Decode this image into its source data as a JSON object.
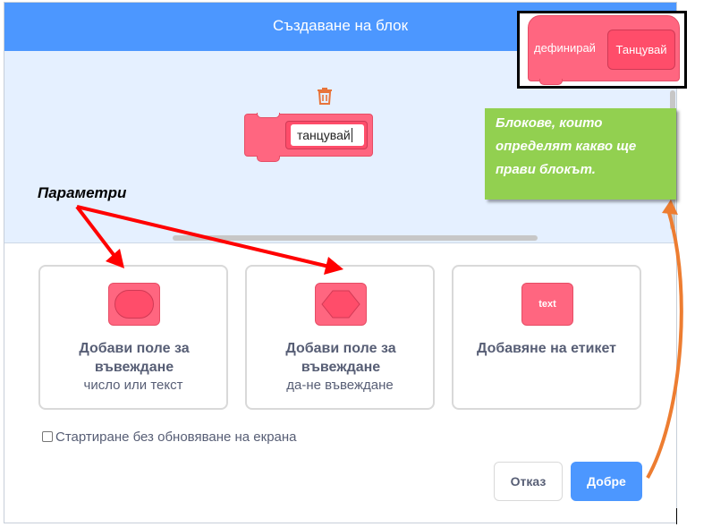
{
  "dialog": {
    "title": "Създаване на блок"
  },
  "prototype_block": {
    "input_value": "танцувай"
  },
  "options": [
    {
      "title": "Добави поле за въвеждане",
      "subtitle": "число или текст",
      "icon": "round-input-icon"
    },
    {
      "title": "Добави поле за въвеждане",
      "subtitle": "да-не въвеждане",
      "icon": "boolean-input-icon"
    },
    {
      "title": "Добавяне на етикет",
      "subtitle": "",
      "icon": "label-icon",
      "icon_text": "text"
    }
  ],
  "checkbox": {
    "label": "Стартиране без обновяване на екрана",
    "checked": false
  },
  "buttons": {
    "cancel": "Отказ",
    "ok": "Добре"
  },
  "annotations": {
    "params_label": "Параметри",
    "note_text": "Блокове, които определят какво ще прави блокът.",
    "inset_define": "дефинирай",
    "inset_name": "Танцувай"
  },
  "colors": {
    "header": "#4c97ff",
    "block": "#ff6680",
    "note": "#92d050",
    "arrow_red": "#ff0000",
    "arrow_orange": "#ed7d31"
  }
}
